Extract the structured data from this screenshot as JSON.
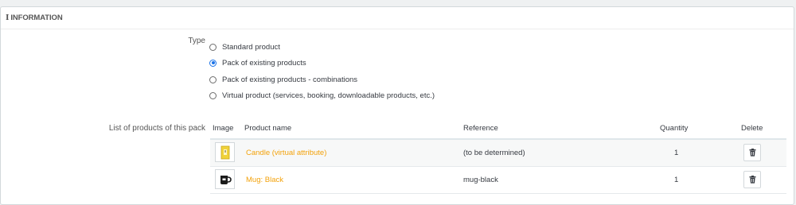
{
  "panel": {
    "heading_icon": "i",
    "heading": "INFORMATION"
  },
  "type_field": {
    "label": "Type",
    "options": [
      {
        "label": "Standard product",
        "checked": false
      },
      {
        "label": "Pack of existing products",
        "checked": true
      },
      {
        "label": "Pack of existing products - combinations",
        "checked": false
      },
      {
        "label": "Virtual product (services, booking, downloadable products, etc.)",
        "checked": false
      }
    ]
  },
  "pack_list": {
    "label": "List of products of this pack",
    "columns": {
      "image": "Image",
      "name": "Product name",
      "reference": "Reference",
      "quantity": "Quantity",
      "delete": "Delete"
    },
    "rows": [
      {
        "image_icon": "candle-icon",
        "name": "Candle (virtual attribute)",
        "reference": "(to be determined)",
        "quantity": "1"
      },
      {
        "image_icon": "mug-icon",
        "name": "Mug: Black",
        "reference": "mug-black",
        "quantity": "1"
      }
    ]
  },
  "colors": {
    "link": "#f3a20b",
    "radio_checked": "#1a73e8"
  }
}
